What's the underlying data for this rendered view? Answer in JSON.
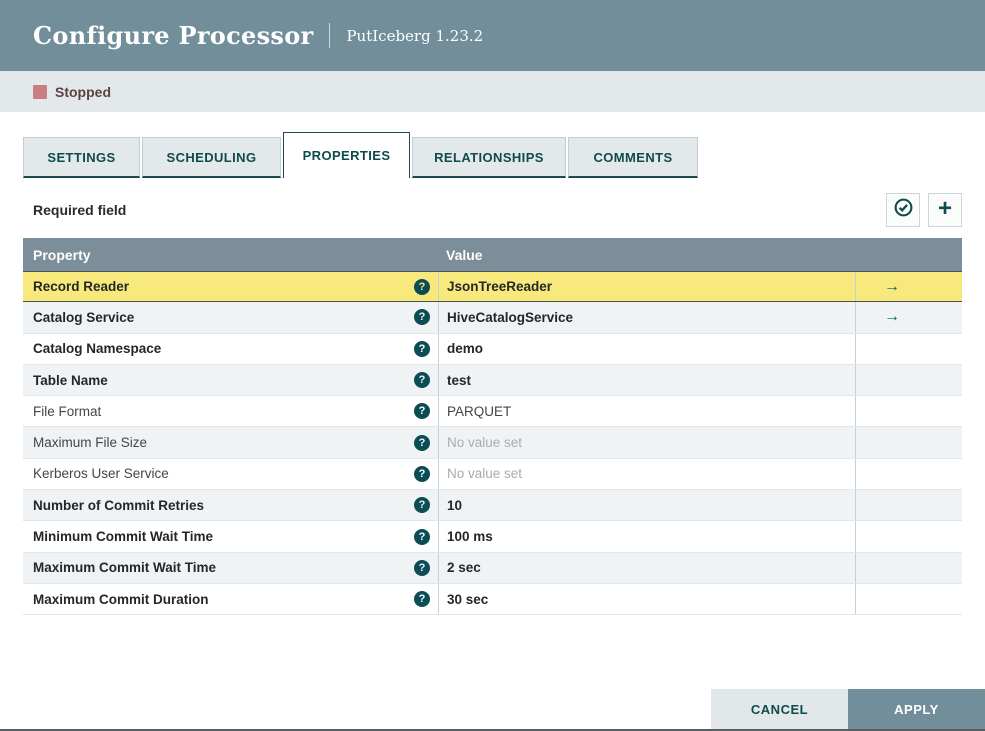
{
  "header": {
    "title": "Configure Processor",
    "subtitle": "PutIceberg 1.23.2"
  },
  "status": {
    "label": "Stopped",
    "color": "#c97f81"
  },
  "tabs": [
    {
      "label": "SETTINGS",
      "active": false
    },
    {
      "label": "SCHEDULING",
      "active": false
    },
    {
      "label": "PROPERTIES",
      "active": true
    },
    {
      "label": "RELATIONSHIPS",
      "active": false
    },
    {
      "label": "COMMENTS",
      "active": false
    }
  ],
  "toolbar": {
    "required_label": "Required field",
    "buttons": [
      {
        "icon": "verify-properties-icon"
      },
      {
        "icon": "add-property-icon"
      }
    ]
  },
  "icons": {
    "help_glyph": "?",
    "goto_arrow_glyph": "→",
    "plus_glyph": "+"
  },
  "table": {
    "columns": [
      "Property",
      "Value"
    ],
    "rows": [
      {
        "property": "Record Reader",
        "value": "JsonTreeReader",
        "required": true,
        "unset": false,
        "has_link": true,
        "selected": true
      },
      {
        "property": "Catalog Service",
        "value": "HiveCatalogService",
        "required": true,
        "unset": false,
        "has_link": true,
        "selected": false
      },
      {
        "property": "Catalog Namespace",
        "value": "demo",
        "required": true,
        "unset": false,
        "has_link": false,
        "selected": false
      },
      {
        "property": "Table Name",
        "value": "test",
        "required": true,
        "unset": false,
        "has_link": false,
        "selected": false
      },
      {
        "property": "File Format",
        "value": "PARQUET",
        "required": false,
        "unset": false,
        "has_link": false,
        "selected": false
      },
      {
        "property": "Maximum File Size",
        "value": "No value set",
        "required": false,
        "unset": true,
        "has_link": false,
        "selected": false
      },
      {
        "property": "Kerberos User Service",
        "value": "No value set",
        "required": false,
        "unset": true,
        "has_link": false,
        "selected": false
      },
      {
        "property": "Number of Commit Retries",
        "value": "10",
        "required": true,
        "unset": false,
        "has_link": false,
        "selected": false
      },
      {
        "property": "Minimum Commit Wait Time",
        "value": "100 ms",
        "required": true,
        "unset": false,
        "has_link": false,
        "selected": false
      },
      {
        "property": "Maximum Commit Wait Time",
        "value": "2 sec",
        "required": true,
        "unset": false,
        "has_link": false,
        "selected": false
      },
      {
        "property": "Maximum Commit Duration",
        "value": "30 sec",
        "required": true,
        "unset": false,
        "has_link": false,
        "selected": false
      }
    ]
  },
  "footer": {
    "cancel_label": "CANCEL",
    "apply_label": "APPLY"
  },
  "colors": {
    "header_bg": "#728e9b",
    "status_bg": "#e3e8eb",
    "accent_teal": "#0f4b4d",
    "selected_row_bg": "#f8e97c",
    "table_header_bg": "#7b8e99"
  }
}
